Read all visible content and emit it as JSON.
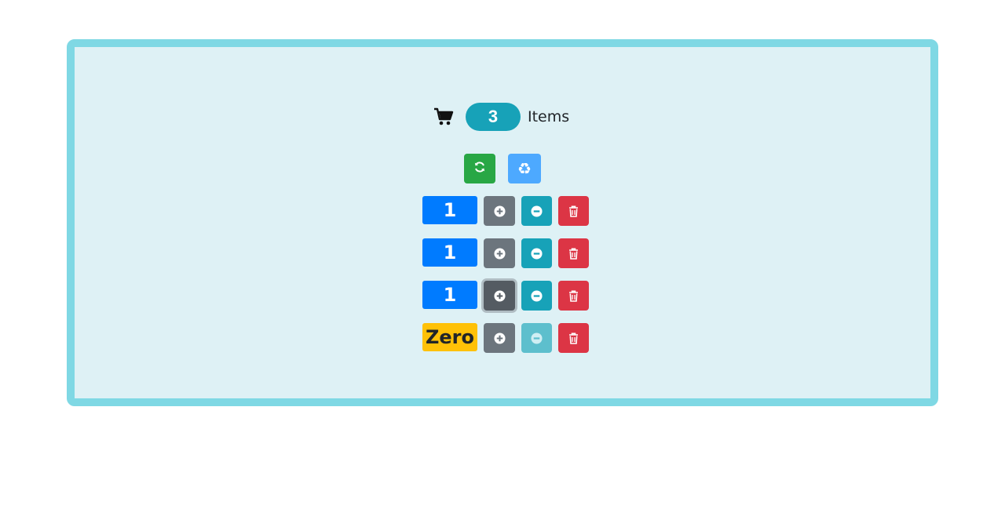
{
  "cart": {
    "count": "3",
    "label": "Items",
    "icon": "cart-icon"
  },
  "actions": {
    "refresh_icon": "refresh-icon",
    "recycle_icon": "recycle-icon",
    "recycle_glyph": "♻"
  },
  "counters": [
    {
      "value": "1",
      "style": "primary"
    },
    {
      "value": "1",
      "style": "primary"
    },
    {
      "value": "1",
      "style": "primary"
    },
    {
      "value": "Zero",
      "style": "warning"
    }
  ],
  "colors": {
    "panel_border": "#7fd8e4",
    "panel_bg": "#def1f5",
    "badge": "#17a2b8",
    "primary": "#007bff",
    "warning": "#ffc107",
    "secondary": "#6c757d",
    "info": "#17a2b8",
    "danger": "#dc3545",
    "success": "#28a745"
  }
}
